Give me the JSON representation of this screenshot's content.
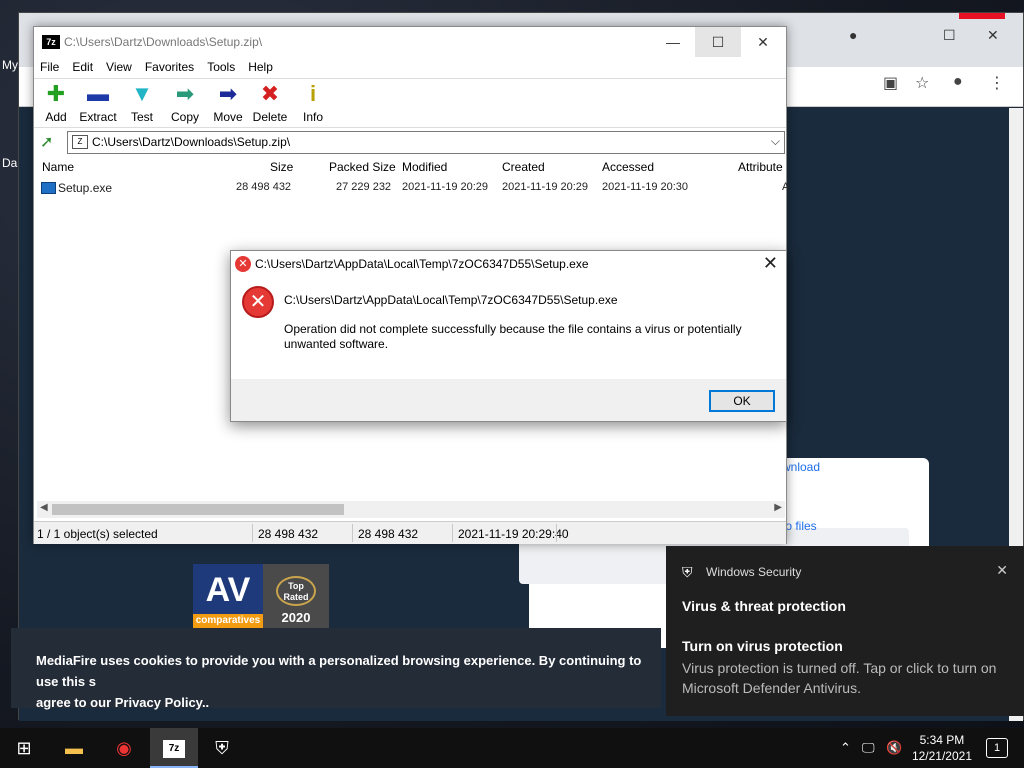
{
  "desktop": {
    "label1": "My",
    "label2": "Da"
  },
  "browser": {
    "download_link": "wnload",
    "files_link": "to files",
    "cookie_line1": "MediaFire uses cookies to provide you with a personalized browsing experience. By continuing to use this s",
    "cookie_line2": "agree to our Privacy Policy..",
    "av_badge": {
      "brand": "AV",
      "sub": "comparatives",
      "top_rated": "Top Rated",
      "year": "2020"
    }
  },
  "sevenzip": {
    "title": "C:\\Users\\Dartz\\Downloads\\Setup.zip\\",
    "menu": [
      "File",
      "Edit",
      "View",
      "Favorites",
      "Tools",
      "Help"
    ],
    "toolbar": [
      {
        "label": "Add",
        "icon": "add-icon",
        "glyph": "✚",
        "color": "#22a022"
      },
      {
        "label": "Extract",
        "icon": "extract-icon",
        "glyph": "▬",
        "color": "#1c3aa8"
      },
      {
        "label": "Test",
        "icon": "test-icon",
        "glyph": "▼",
        "color": "#22b5c5"
      },
      {
        "label": "Copy",
        "icon": "copy-icon",
        "glyph": "➡",
        "color": "#2a9a7a"
      },
      {
        "label": "Move",
        "icon": "move-icon",
        "glyph": "➡",
        "color": "#1c2a9a"
      },
      {
        "label": "Delete",
        "icon": "delete-icon",
        "glyph": "✖",
        "color": "#d42020"
      },
      {
        "label": "Info",
        "icon": "info-icon",
        "glyph": "i",
        "color": "#b8a000"
      }
    ],
    "address": "C:\\Users\\Dartz\\Downloads\\Setup.zip\\",
    "columns": [
      "Name",
      "Size",
      "Packed Size",
      "Modified",
      "Created",
      "Accessed",
      "Attribute"
    ],
    "rows": [
      {
        "name": "Setup.exe",
        "size": "28 498 432",
        "packed": "27 229 232",
        "modified": "2021-11-19 20:29",
        "created": "2021-11-19 20:29",
        "accessed": "2021-11-19 20:30",
        "attr": "A"
      }
    ],
    "status": {
      "selected": "1 / 1 object(s) selected",
      "size": "28 498 432",
      "packed": "28 498 432",
      "date": "2021-11-19 20:29:40"
    }
  },
  "dialog": {
    "title": "C:\\Users\\Dartz\\AppData\\Local\\Temp\\7zOC6347D55\\Setup.exe",
    "path": "C:\\Users\\Dartz\\AppData\\Local\\Temp\\7zOC6347D55\\Setup.exe",
    "message": "Operation did not complete successfully because the file contains a virus or potentially unwanted software.",
    "ok_label": "OK"
  },
  "toast": {
    "app": "Windows Security",
    "heading": "Virus & threat protection",
    "subheading": "Turn on virus protection",
    "body": "Virus protection is turned off. Tap or click to turn on Microsoft Defender Antivirus."
  },
  "taskbar": {
    "time": "5:34 PM",
    "date": "12/21/2021",
    "notification_count": "1",
    "zip_label": "7z"
  }
}
